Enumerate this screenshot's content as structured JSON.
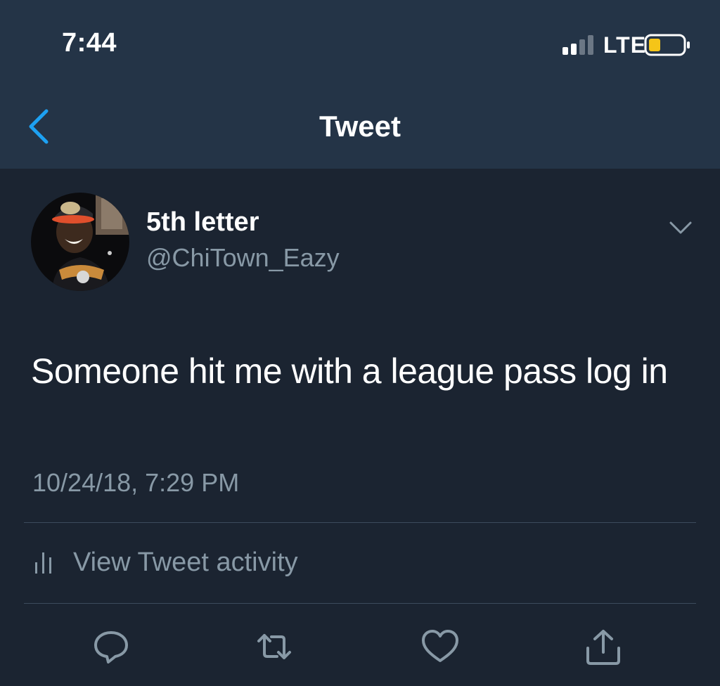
{
  "status_bar": {
    "time": "7:44",
    "network": "LTE",
    "battery_color": "#f5c518"
  },
  "nav": {
    "title": "Tweet",
    "back_icon": "chevron-left-icon",
    "accent": "#1da1f2"
  },
  "tweet": {
    "display_name": "5th letter",
    "handle": "@ChiTown_Eazy",
    "text": "Someone hit me with a league pass log in",
    "timestamp": "10/24/18, 7:29 PM",
    "menu_icon": "chevron-down-icon"
  },
  "activity": {
    "label": "View Tweet activity",
    "icon": "bar-chart-icon"
  },
  "actions": [
    {
      "name": "reply",
      "icon": "comment-icon"
    },
    {
      "name": "retweet",
      "icon": "retweet-icon"
    },
    {
      "name": "like",
      "icon": "heart-icon"
    },
    {
      "name": "share",
      "icon": "share-icon"
    }
  ],
  "colors": {
    "background": "#1b2431",
    "header": "#243447",
    "secondary_text": "#8899a6",
    "divider": "#3d4b5c"
  }
}
